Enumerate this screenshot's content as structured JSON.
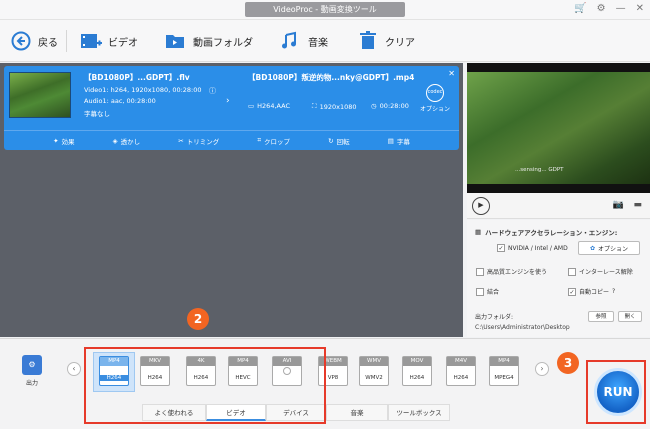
{
  "window": {
    "title": "VideoProc - 動画変換ツール"
  },
  "toolbar": {
    "back": "戻る",
    "video": "ビデオ",
    "folder": "動画フォルダ",
    "music": "音楽",
    "clear": "クリア"
  },
  "item": {
    "input_title": "【BD1080P】...GDPT】.flv",
    "input_video": "Video1: h264, 1920x1080, 00:28:00",
    "input_audio": "Audio1: aac, 00:28:00",
    "input_sub": "字幕なし",
    "output_title": "【BD1080P】叛逆的物...nky@GDPT】.mp4",
    "out_codec": "H264,AAC",
    "out_res": "1920x1080",
    "out_dur": "00:28:00",
    "codec_btn": "オプション",
    "codec_icon": "codec",
    "edit": [
      "効果",
      "透かし",
      "トリミング",
      "クロップ",
      "回転",
      "字幕"
    ]
  },
  "preview": {
    "subtitle": "...sensing... GDPT"
  },
  "settings": {
    "hw_title": "ハードウェアアクセラレーション・エンジン:",
    "hw_check": "NVIDIA / Intel / AMD",
    "option_btn": "オプション",
    "hq_engine": "高品質エンジンを使う",
    "deinterlace": "インターレース解除",
    "merge": "結合",
    "auto_copy": "自動コピー",
    "out_folder_label": "出力フォルダ:",
    "out_path": "C:\\Users\\Administrator\\Desktop",
    "browse": "参照",
    "open": "開く"
  },
  "bottom": {
    "output_label": "出力",
    "formats": [
      {
        "top": "MP4",
        "bot": "H264"
      },
      {
        "top": "MKV",
        "bot": "H264"
      },
      {
        "top": "4K",
        "bot": "H264"
      },
      {
        "top": "MP4",
        "bot": "HEVC"
      },
      {
        "top": "AVI",
        "bot": ""
      },
      {
        "top": "WEBM",
        "bot": "VP8"
      },
      {
        "top": "WMV",
        "bot": "WMV2"
      },
      {
        "top": "MOV",
        "bot": "H264"
      },
      {
        "top": "M4V",
        "bot": "H264"
      },
      {
        "top": "MP4",
        "bot": "MPEG4"
      }
    ],
    "tabs": [
      "よく使われる",
      "ビデオ",
      "デバイス",
      "音楽",
      "ツールボックス"
    ],
    "run": "RUN"
  },
  "badges": [
    "2",
    "3"
  ]
}
